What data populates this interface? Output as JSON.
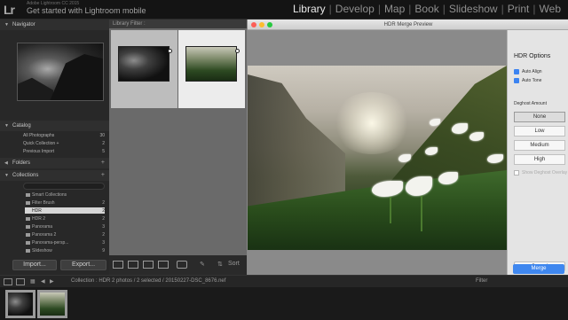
{
  "identity": {
    "user": "Adobe Lightroom CC 2015",
    "tagline": "Get started with Lightroom mobile",
    "logo": "Lr"
  },
  "modules": [
    "Library",
    "Develop",
    "Map",
    "Book",
    "Slideshow",
    "Print",
    "Web"
  ],
  "active_module": "Library",
  "left_panel": {
    "navigator_title": "Navigator",
    "catalog_title": "Catalog",
    "catalog_items": [
      {
        "label": "All Photographs",
        "count": "30"
      },
      {
        "label": "Quick Collection +",
        "count": "2"
      },
      {
        "label": "Previous Import",
        "count": "5"
      }
    ],
    "folders_title": "Folders",
    "collections_title": "Collections",
    "collection_items": [
      {
        "label": "Smart Collections",
        "count": ""
      },
      {
        "label": "Filter Brush",
        "count": "2"
      },
      {
        "label": "HDR",
        "count": "2"
      },
      {
        "label": "HDR 2",
        "count": "2"
      },
      {
        "label": "Panorama",
        "count": "3"
      },
      {
        "label": "Panorama 2",
        "count": "2"
      },
      {
        "label": "Panorama-persp...",
        "count": "3"
      },
      {
        "label": "Slideshow",
        "count": "9"
      }
    ],
    "import_label": "Import...",
    "export_label": "Export..."
  },
  "grid": {
    "filter_label": "Library Filter :",
    "cells": [
      {
        "index": "1"
      },
      {
        "index": "2"
      }
    ]
  },
  "toolbar": {
    "sort_label": "Sort"
  },
  "filmstrip_bar": {
    "path_text": "Collection : HDR    2 photos / 2 selected / 20150227-DSC_8676.nef",
    "filter_label": "Filter"
  },
  "dialog": {
    "title": "HDR Merge Preview",
    "options_title": "HDR Options",
    "auto_align": "Auto Align",
    "auto_tone": "Auto Tone",
    "deghost_label": "Deghost Amount",
    "deghost_options": [
      "None",
      "Low",
      "Medium",
      "High"
    ],
    "selected_deghost": "None",
    "show_overlay": "Show Deghost Overlay",
    "cancel_label": "Cancel",
    "merge_label": "Merge"
  },
  "colors": {
    "accent": "#3f87ef",
    "panel_bg": "#282828",
    "selected_row": "#d6d6d6"
  }
}
